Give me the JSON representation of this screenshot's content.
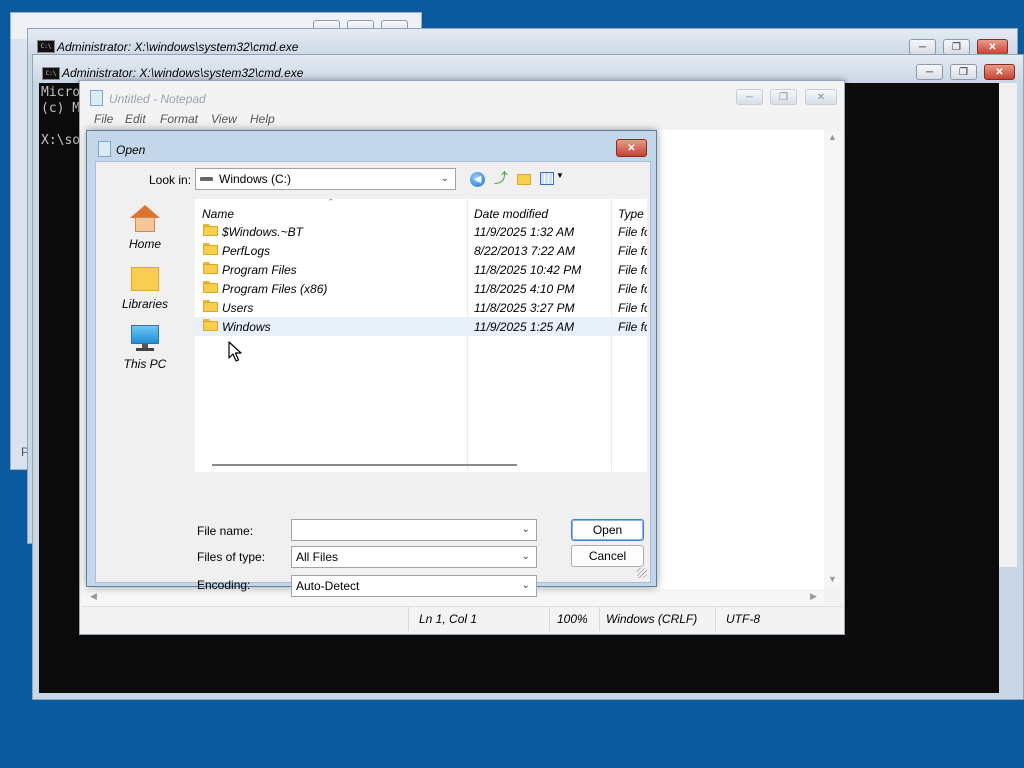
{
  "back_window": {
    "title": "",
    "status": "P"
  },
  "cmd1": {
    "title": "Administrator: X:\\windows\\system32\\cmd.exe"
  },
  "cmd2": {
    "title": "Administrator: X:\\windows\\system32\\cmd.exe",
    "lines": [
      "Micro",
      "(c) M",
      "",
      "X:\\so"
    ]
  },
  "notepad": {
    "title": "Untitled - Notepad",
    "menu": [
      "File",
      "Edit",
      "Format",
      "View",
      "Help"
    ],
    "status": {
      "position": "Ln 1, Col 1",
      "zoom": "100%",
      "line_ending": "Windows (CRLF)",
      "encoding": "UTF-8"
    }
  },
  "dialog": {
    "title": "Open",
    "look_in_label": "Look in:",
    "look_in_value": "Windows (C:)",
    "places": [
      {
        "label": "Home",
        "icon": "home-icon"
      },
      {
        "label": "Libraries",
        "icon": "libraries-icon"
      },
      {
        "label": "This PC",
        "icon": "computer-icon"
      }
    ],
    "columns": [
      "Name",
      "Date modified",
      "Type"
    ],
    "files": [
      {
        "name": "$Windows.~BT",
        "date": "11/9/2025 1:32 AM",
        "type": "File fo"
      },
      {
        "name": "PerfLogs",
        "date": "8/22/2013 7:22 AM",
        "type": "File fo"
      },
      {
        "name": "Program Files",
        "date": "11/8/2025 10:42 PM",
        "type": "File fo"
      },
      {
        "name": "Program Files (x86)",
        "date": "11/8/2025 4:10 PM",
        "type": "File fo"
      },
      {
        "name": "Users",
        "date": "11/8/2025 3:27 PM",
        "type": "File fo"
      },
      {
        "name": "Windows",
        "date": "11/9/2025 1:25 AM",
        "type": "File fo"
      }
    ],
    "file_name_label": "File name:",
    "file_name_value": "",
    "files_of_type_label": "Files of type:",
    "files_of_type_value": "All Files",
    "encoding_label": "Encoding:",
    "encoding_value": "Auto-Detect",
    "open_label": "Open",
    "cancel_label": "Cancel"
  }
}
